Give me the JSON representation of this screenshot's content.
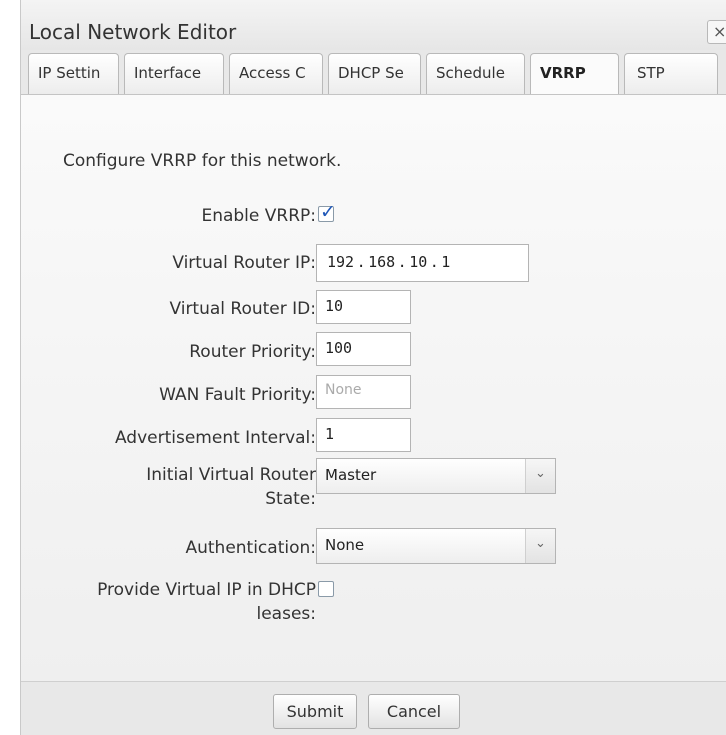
{
  "dialog": {
    "title": "Local Network Editor",
    "close_label": "×"
  },
  "tabs": [
    {
      "label": "IP Settin"
    },
    {
      "label": "Interface"
    },
    {
      "label": "Access C"
    },
    {
      "label": "DHCP Se"
    },
    {
      "label": "Schedule"
    },
    {
      "label": "VRRP",
      "active": true
    },
    {
      "label": "STP"
    }
  ],
  "form": {
    "intro": "Configure VRRP for this network.",
    "enable_vrrp": {
      "label": "Enable VRRP:",
      "checked": true
    },
    "virtual_router_ip": {
      "label": "Virtual Router IP:",
      "octets": [
        "192",
        "168",
        "10",
        "1"
      ]
    },
    "virtual_router_id": {
      "label": "Virtual Router ID:",
      "value": "10"
    },
    "router_priority": {
      "label": "Router Priority:",
      "value": "100"
    },
    "wan_fault_priority": {
      "label": "WAN Fault Priority:",
      "value": "None"
    },
    "advertisement_interval": {
      "label": "Advertisement Interval:",
      "value": "1"
    },
    "initial_state": {
      "label_line1": "Initial Virtual Router",
      "label_line2": "State:",
      "value": "Master"
    },
    "authentication": {
      "label": "Authentication:",
      "value": "None"
    },
    "provide_vip": {
      "label_line1": "Provide Virtual IP in DHCP",
      "label_line2": "leases:",
      "checked": false
    }
  },
  "buttons": {
    "submit": "Submit",
    "cancel": "Cancel"
  }
}
